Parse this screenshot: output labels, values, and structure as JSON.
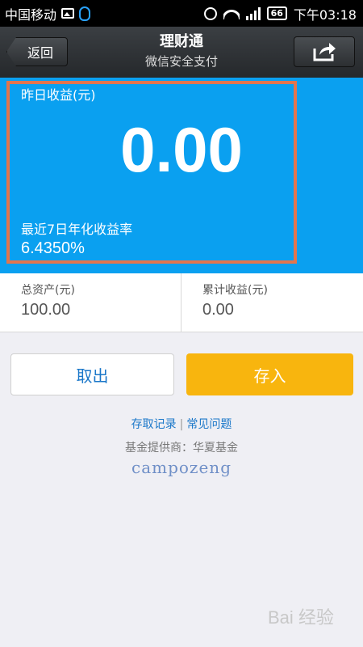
{
  "status_bar": {
    "carrier": "中国移动",
    "battery": "66",
    "time": "下午03:18"
  },
  "header": {
    "back_label": "返回",
    "title": "理财通",
    "subtitle": "微信安全支付",
    "share_icon": "share-icon"
  },
  "income": {
    "yesterday_label": "昨日收益(元)",
    "yesterday_value": "0.00",
    "rate_label": "最近7日年化收益率",
    "rate_value": "6.4350%"
  },
  "assets": {
    "total_label": "总资产(元)",
    "total_value": "100.00",
    "cumulative_label": "累计收益(元)",
    "cumulative_value": "0.00"
  },
  "actions": {
    "withdraw_label": "取出",
    "deposit_label": "存入"
  },
  "links": {
    "records": "存取记录",
    "separator": "|",
    "faq": "常见问题"
  },
  "provider": "基金提供商：华夏基金",
  "signature": "campozeng",
  "watermark": "Bai 经验",
  "colors": {
    "panel": "#0aa0f0",
    "highlight_border": "#e2754e",
    "deposit_button": "#f8b50e",
    "link": "#1a77c9"
  }
}
